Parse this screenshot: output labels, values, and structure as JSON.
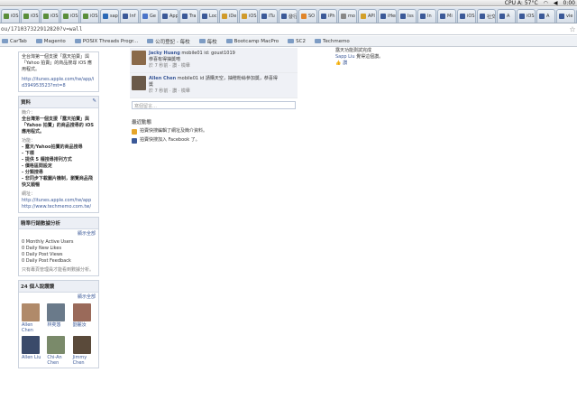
{
  "status": {
    "cpu": "CPU A: 57°C",
    "time": "0:00"
  },
  "tabs": [
    {
      "label": "iOS",
      "color": "#5a8e3a"
    },
    {
      "label": "iOS",
      "color": "#5a8e3a"
    },
    {
      "label": "iOS",
      "color": "#5a8e3a"
    },
    {
      "label": "iOS",
      "color": "#5a8e3a"
    },
    {
      "label": "iOS",
      "color": "#5a8e3a"
    },
    {
      "label": "sap",
      "color": "#2b69b6"
    },
    {
      "label": "Inf",
      "color": "#3b5998"
    },
    {
      "label": "Ge",
      "color": "#4a74c9"
    },
    {
      "label": "App",
      "color": "#3b5998"
    },
    {
      "label": "Tra",
      "color": "#3b5998"
    },
    {
      "label": "Loc",
      "color": "#3b5998"
    },
    {
      "label": "iDe",
      "color": "#d09a2a"
    },
    {
      "label": "iOS",
      "color": "#d09a2a"
    },
    {
      "label": "iTu",
      "color": "#3b5998"
    },
    {
      "label": "發行",
      "color": "#3b5998"
    },
    {
      "label": "SO",
      "color": "#e0852a"
    },
    {
      "label": "iPh",
      "color": "#3b5998"
    },
    {
      "label": "mo",
      "color": "#888888"
    },
    {
      "label": "API",
      "color": "#d3a02a"
    },
    {
      "label": "iHer",
      "color": "#3b5998"
    },
    {
      "label": "Iss",
      "color": "#3b5998"
    },
    {
      "label": "In",
      "color": "#3b5998"
    },
    {
      "label": "Mi",
      "color": "#3b5998"
    },
    {
      "label": "iOS",
      "color": "#3b5998"
    },
    {
      "label": "社交",
      "color": "#3b5998"
    },
    {
      "label": "A",
      "color": "#3b5998"
    },
    {
      "label": "iOS",
      "color": "#3b5998"
    },
    {
      "label": "A",
      "color": "#3b5998"
    },
    {
      "label": "vie",
      "color": "#3b5998"
    },
    {
      "label": "加",
      "color": "#3b5998"
    }
  ],
  "address": {
    "url": "ou/171037322912820?v=wall"
  },
  "bookmarks": [
    {
      "label": "CarTab"
    },
    {
      "label": "Magento"
    },
    {
      "label": "POSIX Threads Progr..."
    },
    {
      "label": "公司登記 - 每校"
    },
    {
      "label": "每校"
    },
    {
      "label": "Bootcamp MacPro"
    },
    {
      "label": "SC2"
    },
    {
      "label": "Techmemo"
    }
  ],
  "left": {
    "intro_text": "全台灣第一個支援「露天拍賣」與「Yahoo 拍賣」的商品搜尋 iOS 應用程式。",
    "intro_url": "http://itunes.apple.com/tw/app/id394953523?mt=8",
    "info": {
      "title": "資料",
      "about_label": "簡介：",
      "about": "全台灣第一個支援「露天拍賣」與「Yahoo 拍賣」的商品搜尋的 iOS 應用程式。",
      "features_label": "功能：",
      "features": [
        "- 露天/Yahoo拍賣的商品搜尋",
        "- 下標",
        "- 提供 5 種搜尋排列方式",
        "- 價格區間設定",
        "- 分類搜尋",
        "- 非同步下載圖片機制，瀏覽商品飛快又順暢"
      ],
      "website_label": "網址：",
      "websites": [
        "http://itunes.apple.com/tw/app",
        "http://www.techmemo.com.tw/"
      ]
    },
    "analytics": {
      "title": "精準行銷數據分析",
      "see_all": "顯示全部",
      "stats": [
        "0 Monthly Active Users",
        "0 Daily New Likes",
        "0 Daily Post Views",
        "0 Daily Post Feedback"
      ],
      "note": "只有專頁管理員才能看到數據分析。"
    },
    "friends": {
      "title": "24 個人說讚讚",
      "see_all": "顯示全部",
      "people": [
        {
          "name": "Allen Chen",
          "color": "#b08a6a"
        },
        {
          "name": "林奕悠",
          "color": "#6a7a8a"
        },
        {
          "name": "劉麗汝",
          "color": "#9a6a5a"
        },
        {
          "name": "Allen Liu",
          "color": "#3a4a6a"
        },
        {
          "name": "Chi-An Chen",
          "color": "#7a8a6a"
        },
        {
          "name": "Jimmy Chen",
          "color": "#5a4a3a"
        }
      ]
    }
  },
  "feed": {
    "posts": [
      {
        "name": "Jacky Huang",
        "text": "mobile01 id: goust1019",
        "text2": "恭喜有得抽獎唷",
        "meta": "於 7 秒前 · 讚 · 檢舉",
        "color": "#8a6a4a"
      },
      {
        "name": "Allen Chen",
        "text": "mobile01 id 請購天空，抽贈粉絲參加獎，恭喜得",
        "text2": "獎",
        "meta": "於 7 秒前 · 讚 · 檢舉",
        "color": "#6a5a4a"
      }
    ],
    "comment_placeholder": "寫個留言…",
    "recent": {
      "title": "最近動態",
      "items": [
        {
          "text": "拍賣快搜編輯了網址及簡介資料。",
          "icon_color": "#e5a52a"
        },
        {
          "text": "拍賣快搜加入 Facebook 了。",
          "icon_color": "#3b5998"
        }
      ]
    }
  },
  "right": {
    "text": "露天功能測試完成",
    "name": "Sapp Liu",
    "action": "覺得這個讚。",
    "like_label": "讚"
  }
}
